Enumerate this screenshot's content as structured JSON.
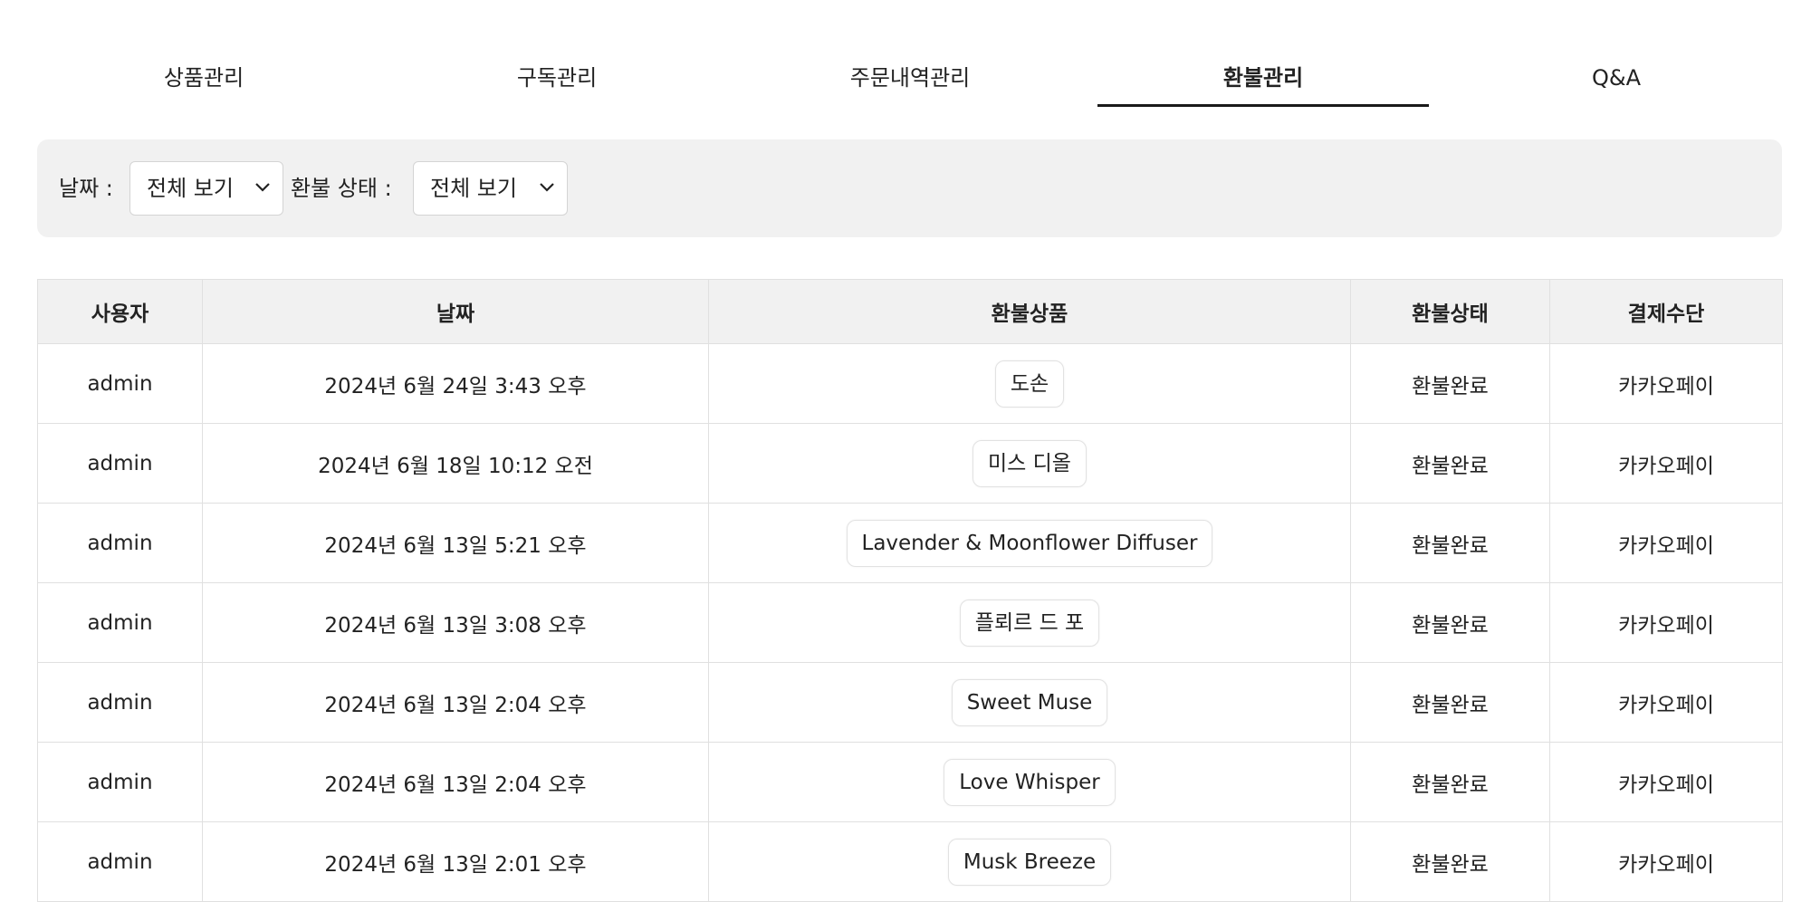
{
  "tabs": [
    {
      "label": "상품관리"
    },
    {
      "label": "구독관리"
    },
    {
      "label": "주문내역관리"
    },
    {
      "label": "환불관리",
      "active": true
    },
    {
      "label": "Q&A"
    }
  ],
  "filters": {
    "date_label": "날짜 :",
    "date_value": "전체 보기",
    "status_label": "환불 상태 :",
    "status_value": "전체 보기"
  },
  "table": {
    "headers": [
      "사용자",
      "날짜",
      "환불상품",
      "환불상태",
      "결제수단"
    ],
    "rows": [
      {
        "user": "admin",
        "date": "2024년 6월 24일 3:43 오후",
        "product": "도손",
        "status": "환불완료",
        "payment": "카카오페이"
      },
      {
        "user": "admin",
        "date": "2024년 6월 18일 10:12 오전",
        "product": "미스 디올",
        "status": "환불완료",
        "payment": "카카오페이"
      },
      {
        "user": "admin",
        "date": "2024년 6월 13일 5:21 오후",
        "product": "Lavender & Moonflower Diffuser",
        "status": "환불완료",
        "payment": "카카오페이"
      },
      {
        "user": "admin",
        "date": "2024년 6월 13일 3:08 오후",
        "product": "플뢰르 드 포",
        "status": "환불완료",
        "payment": "카카오페이"
      },
      {
        "user": "admin",
        "date": "2024년 6월 13일 2:04 오후",
        "product": "Sweet Muse",
        "status": "환불완료",
        "payment": "카카오페이"
      },
      {
        "user": "admin",
        "date": "2024년 6월 13일 2:04 오후",
        "product": "Love Whisper",
        "status": "환불완료",
        "payment": "카카오페이"
      },
      {
        "user": "admin",
        "date": "2024년 6월 13일 2:01 오후",
        "product": "Musk Breeze",
        "status": "환불완료",
        "payment": "카카오페이"
      }
    ]
  },
  "icons": {
    "select_arrow": "chevron-down-icon"
  }
}
